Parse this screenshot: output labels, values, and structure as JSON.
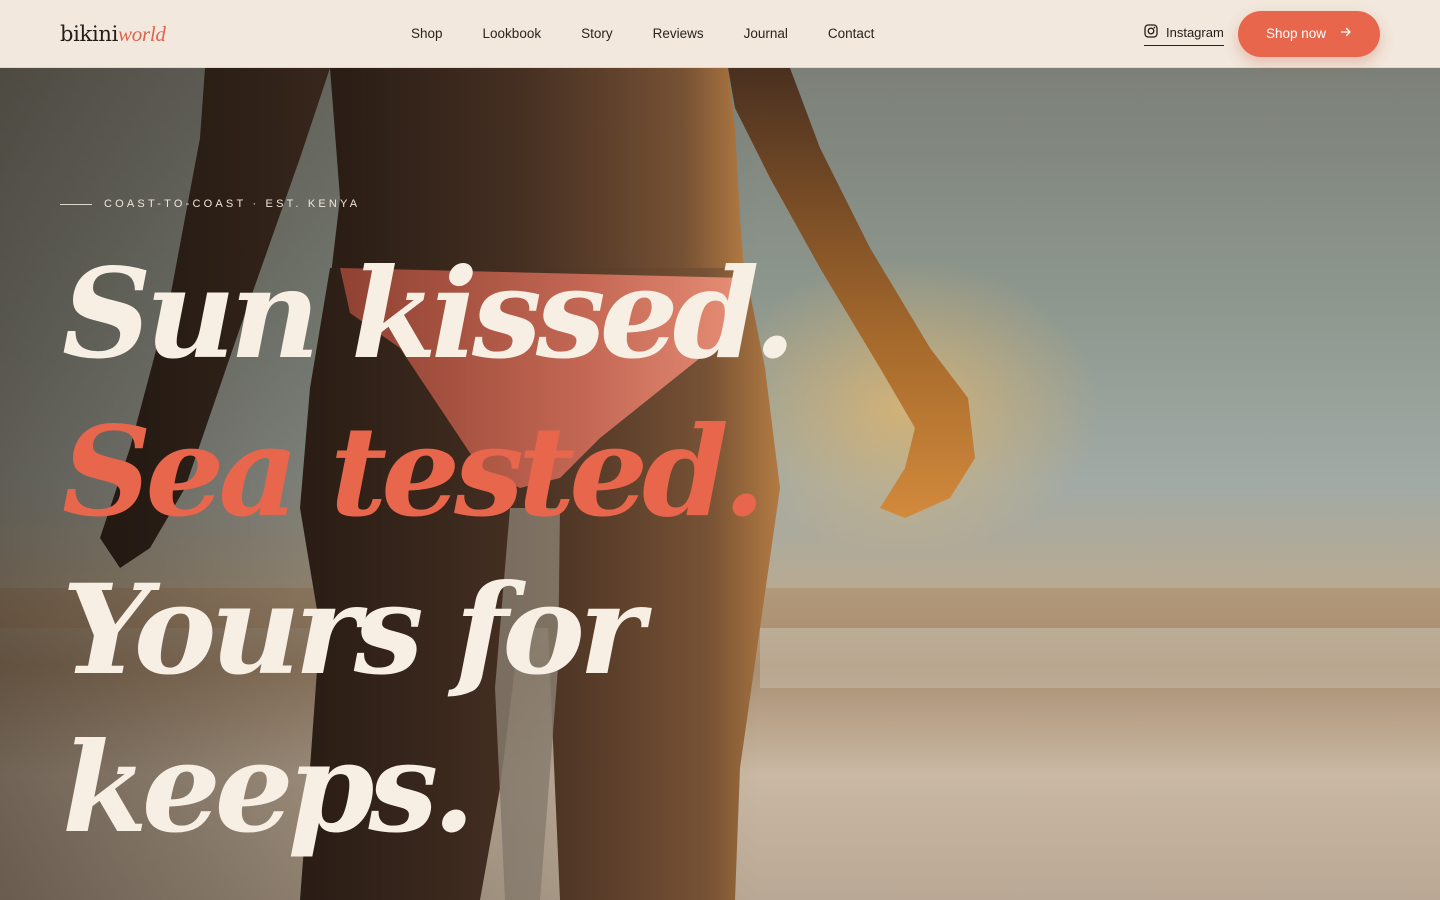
{
  "brand": {
    "logo_main": "bikini",
    "logo_accent": "world"
  },
  "nav": {
    "items": [
      {
        "label": "Shop"
      },
      {
        "label": "Lookbook"
      },
      {
        "label": "Story"
      },
      {
        "label": "Reviews"
      },
      {
        "label": "Journal"
      },
      {
        "label": "Contact"
      }
    ]
  },
  "header": {
    "instagram_label": "Instagram",
    "instagram_icon": "instagram-icon",
    "cta_label": "Shop now",
    "cta_icon": "arrow-right-icon"
  },
  "hero": {
    "eyebrow": "COAST-TO-COAST · EST. KENYA",
    "headline": {
      "line1": "Sun kissed.",
      "line2": "Sea tested.",
      "line3": "Yours for",
      "line4": "keeps."
    },
    "background": "beach-photo"
  },
  "colors": {
    "accent": "#e8664c",
    "cream": "#f7efe4",
    "header_bg": "#f2e8dd",
    "ink": "#231d18"
  }
}
